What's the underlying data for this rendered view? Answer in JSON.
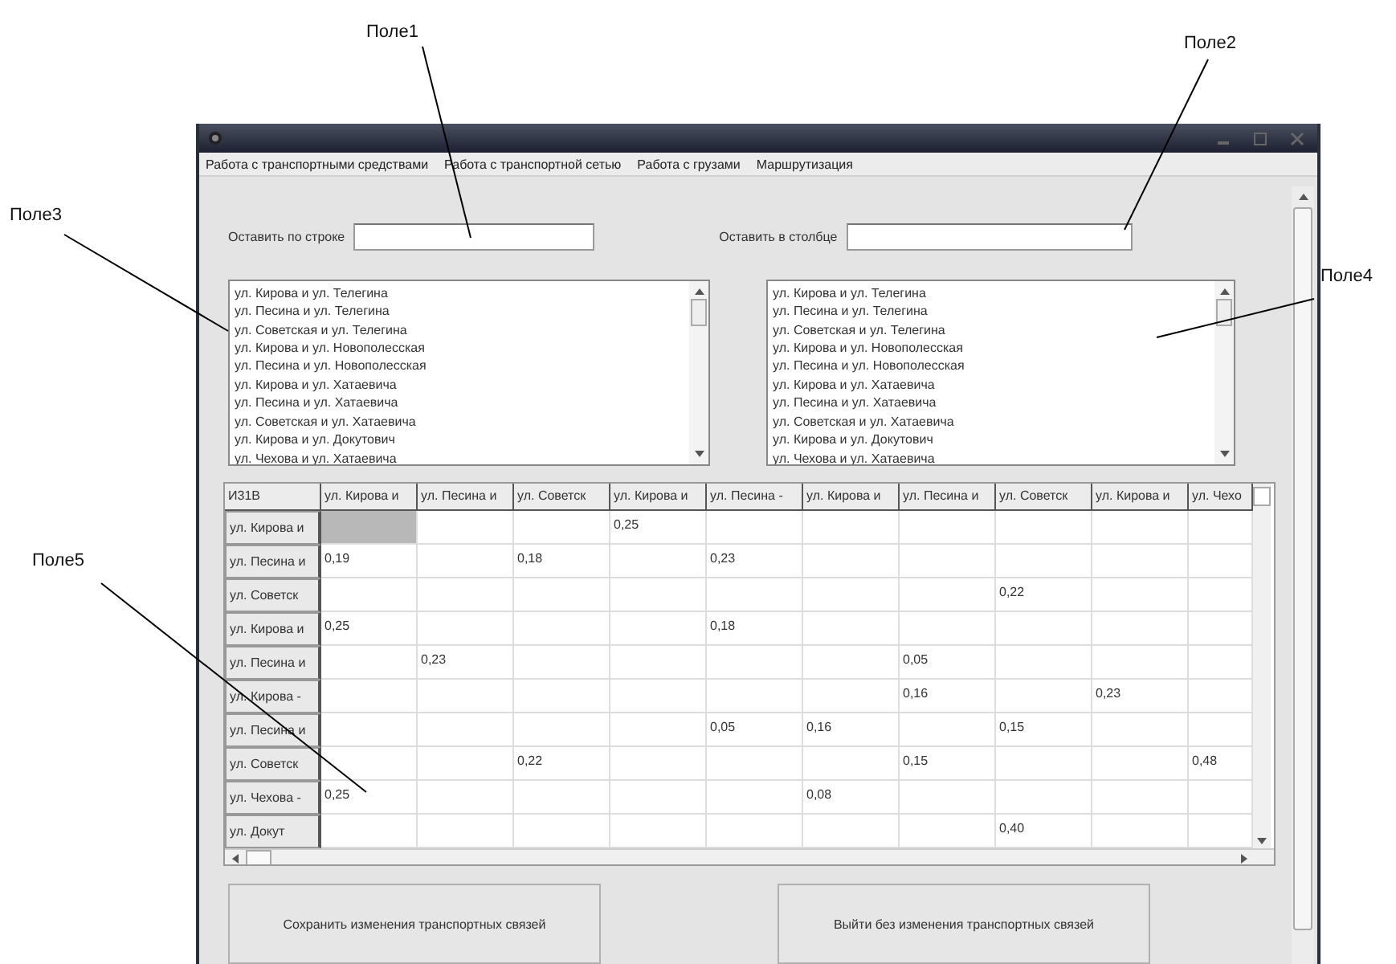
{
  "callouts": [
    {
      "label": "Поле1"
    },
    {
      "label": "Поле2"
    },
    {
      "label": "Поле3"
    },
    {
      "label": "Поле4"
    },
    {
      "label": "Поле5"
    }
  ],
  "menu": [
    "Работа с транспортными средствами",
    "Работа с транспортной сетью",
    "Работа с грузами",
    "Маршрутизация"
  ],
  "filters": [
    {
      "label": "Оставить по строке"
    },
    {
      "label": "Оставить в столбце"
    }
  ],
  "lists": [
    {
      "items": [
        "ул. Кирова и ул. Телегина",
        "ул. Песина и ул. Телегина",
        "ул. Советская и ул. Телегина",
        "ул. Кирова и ул. Новополесская",
        "ул. Песина и ул. Новополесская",
        "ул. Кирова и ул. Хатаевича",
        "ул. Песина и ул. Хатаевича",
        "ул. Советская и ул. Хатаевича",
        "ул. Кирова и ул. Докутович",
        "ул. Чехова и ул. Хатаевича"
      ]
    },
    {
      "items": [
        "ул. Кирова и ул. Телегина",
        "ул. Песина и ул. Телегина",
        "ул. Советская и ул. Телегина",
        "ул. Кирова и ул. Новополесская",
        "ул. Песина и ул. Новополесская",
        "ул. Кирова и ул. Хатаевича",
        "ул. Песина и ул. Хатаевича",
        "ул. Советская и ул. Хатаевича",
        "ул. Кирова и ул. Докутович",
        "ул. Чехова и ул. Хатаевича"
      ]
    }
  ],
  "table": {
    "corner": "И31В",
    "columns": [
      "ул. Кирова и",
      "ул. Песина и",
      "ул. Советск",
      "ул. Кирова и",
      "ул. Песина -",
      "ул. Кирова и",
      "ул. Песина и",
      "ул. Советск",
      "ул. Кирова и",
      "ул. Чехо"
    ],
    "rows": [
      {
        "header": "ул. Кирова и",
        "cells": [
          {
            "selected": true
          },
          {
            "selected": false
          },
          {
            "selected": false
          },
          {
            "text": "0,25",
            "selected": false
          },
          {
            "selected": false
          },
          {
            "selected": false
          },
          {
            "selected": false
          },
          {
            "selected": false
          },
          {
            "selected": false
          },
          {
            "selected": false
          }
        ]
      },
      {
        "header": "ул. Песина и",
        "cells": [
          {
            "text": "0,19",
            "selected": false
          },
          {
            "selected": false
          },
          {
            "text": "0,18",
            "selected": false
          },
          {
            "selected": false
          },
          {
            "text": "0,23",
            "selected": false
          },
          {
            "selected": false
          },
          {
            "selected": false
          },
          {
            "selected": false
          },
          {
            "selected": false
          },
          {
            "selected": false
          }
        ]
      },
      {
        "header": "ул. Советск",
        "cells": [
          {
            "selected": false
          },
          {
            "selected": false
          },
          {
            "selected": false
          },
          {
            "selected": false
          },
          {
            "selected": false
          },
          {
            "selected": false
          },
          {
            "selected": false
          },
          {
            "text": "0,22",
            "selected": false
          },
          {
            "selected": false
          },
          {
            "selected": false
          }
        ]
      },
      {
        "header": "ул. Кирова и",
        "cells": [
          {
            "text": "0,25",
            "selected": false
          },
          {
            "selected": false
          },
          {
            "selected": false
          },
          {
            "selected": false
          },
          {
            "text": "0,18",
            "selected": false
          },
          {
            "selected": false
          },
          {
            "selected": false
          },
          {
            "selected": false
          },
          {
            "selected": false
          },
          {
            "selected": false
          }
        ]
      },
      {
        "header": "ул. Песина и",
        "cells": [
          {
            "selected": false
          },
          {
            "text": "0,23",
            "selected": false
          },
          {
            "selected": false
          },
          {
            "selected": false
          },
          {
            "selected": false
          },
          {
            "selected": false
          },
          {
            "text": "0,05",
            "selected": false
          },
          {
            "selected": false
          },
          {
            "selected": false
          },
          {
            "selected": false
          }
        ]
      },
      {
        "header": "ул. Кирова -",
        "cells": [
          {
            "selected": false
          },
          {
            "selected": false
          },
          {
            "selected": false
          },
          {
            "selected": false
          },
          {
            "selected": false
          },
          {
            "selected": false
          },
          {
            "text": "0,16",
            "selected": false
          },
          {
            "selected": false
          },
          {
            "text": "0,23",
            "selected": false
          },
          {
            "selected": false
          }
        ]
      },
      {
        "header": "ул. Песина и",
        "cells": [
          {
            "selected": false
          },
          {
            "selected": false
          },
          {
            "selected": false
          },
          {
            "selected": false
          },
          {
            "text": "0,05",
            "selected": false
          },
          {
            "text": "0,16",
            "selected": false
          },
          {
            "selected": false
          },
          {
            "text": "0,15",
            "selected": false
          },
          {
            "selected": false
          },
          {
            "selected": false
          }
        ]
      },
      {
        "header": "ул. Советск",
        "cells": [
          {
            "selected": false
          },
          {
            "selected": false
          },
          {
            "text": "0,22",
            "selected": false
          },
          {
            "selected": false
          },
          {
            "selected": false
          },
          {
            "selected": false
          },
          {
            "text": "0,15",
            "selected": false
          },
          {
            "selected": false
          },
          {
            "selected": false
          },
          {
            "text": "0,48",
            "selected": false
          }
        ]
      },
      {
        "header": "ул. Чехова -",
        "cells": [
          {
            "text": "0,25",
            "selected": false
          },
          {
            "selected": false
          },
          {
            "selected": false
          },
          {
            "selected": false
          },
          {
            "selected": false
          },
          {
            "text": "0,08",
            "selected": false
          },
          {
            "selected": false
          },
          {
            "selected": false
          },
          {
            "selected": false
          },
          {
            "selected": false
          }
        ]
      },
      {
        "header": "ул. Докут",
        "cells": [
          {
            "selected": false
          },
          {
            "selected": false
          },
          {
            "selected": false
          },
          {
            "selected": false
          },
          {
            "selected": false
          },
          {
            "selected": false
          },
          {
            "selected": false
          },
          {
            "text": "0,40",
            "selected": false
          },
          {
            "selected": false
          },
          {
            "selected": false
          }
        ]
      }
    ]
  },
  "buttons": [
    "Сохранить изменения транспортных связей",
    "Выйти без изменения транспортных связей"
  ]
}
